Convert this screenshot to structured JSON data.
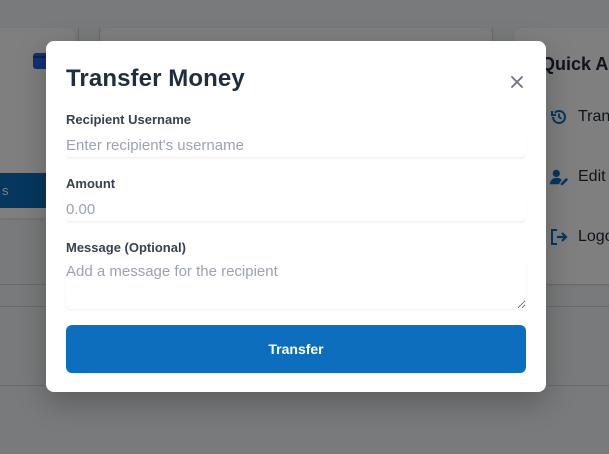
{
  "background": {
    "sidebar_active_fragment": "s",
    "quick_actions": {
      "title": "Quick Ac",
      "items": [
        {
          "label": "Tran",
          "icon": "history-icon"
        },
        {
          "label": "Edit",
          "icon": "user-edit-icon"
        },
        {
          "label": "Logo",
          "icon": "logout-icon"
        }
      ]
    },
    "colors": {
      "primary": "#0d6ebe",
      "wallet": "#2563eb"
    }
  },
  "modal": {
    "title": "Transfer Money",
    "close_icon": "close-icon",
    "fields": {
      "recipient": {
        "label": "Recipient Username",
        "placeholder": "Enter recipient's username",
        "value": ""
      },
      "amount": {
        "label": "Amount",
        "placeholder": "0.00",
        "value": ""
      },
      "message": {
        "label": "Message (Optional)",
        "placeholder": "Add a message for the recipient",
        "value": ""
      }
    },
    "submit_label": "Transfer"
  }
}
